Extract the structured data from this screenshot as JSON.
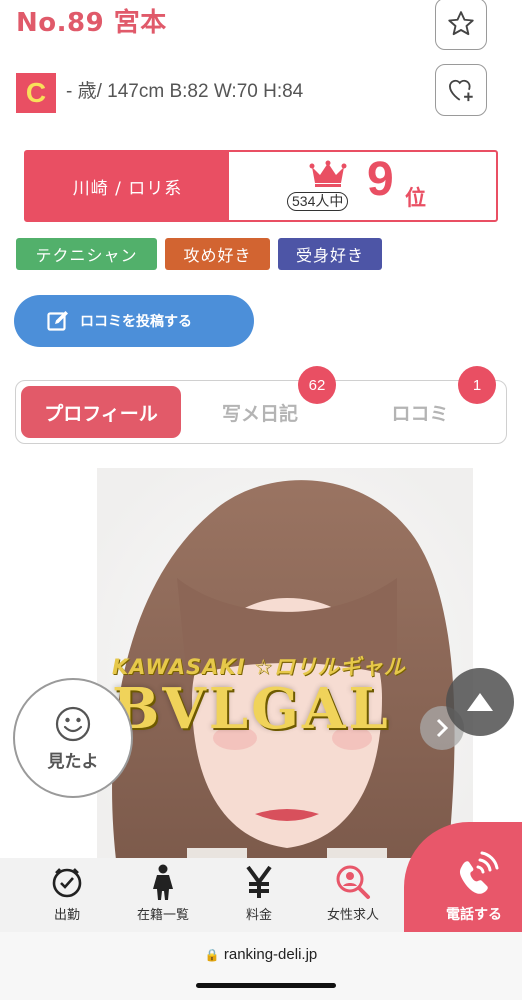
{
  "header": {
    "title": "No.89 宮本"
  },
  "profile": {
    "rank_letter": "C",
    "specs": "- 歳/ 147cm B:82 W:70 H:84"
  },
  "ranking": {
    "category": "川崎 / ロリ系",
    "total": "534人中",
    "rank": "9",
    "rank_suffix": "位"
  },
  "tags": [
    "テクニシャン",
    "攻め好き",
    "受身好き"
  ],
  "review_button": {
    "label": "ロコミを投稿する"
  },
  "tabs": {
    "profile": "プロフィール",
    "diary": "写メ日記",
    "diary_count": "62",
    "review": "ロコミ",
    "review_count": "1"
  },
  "photo": {
    "watermark_line1": "KAWASAKI ☆ロリルギャル",
    "watermark_line2": "BVLGAL"
  },
  "mitayo": {
    "label": "見たよ"
  },
  "bottom_nav": [
    {
      "icon": "clock-icon",
      "label": "出勤"
    },
    {
      "icon": "person-icon",
      "label": "在籍一覧"
    },
    {
      "icon": "yen-icon",
      "label": "料金"
    },
    {
      "icon": "search-person-icon",
      "label": "女性求人"
    }
  ],
  "call": {
    "label": "電話する"
  },
  "browser": {
    "url": "ranking-deli.jp"
  },
  "colors": {
    "accent": "#e94f63",
    "tag_green": "#52b06b",
    "tag_orange": "#d26431",
    "tag_blue": "#4d55a6",
    "button_blue": "#4c8fd9"
  }
}
